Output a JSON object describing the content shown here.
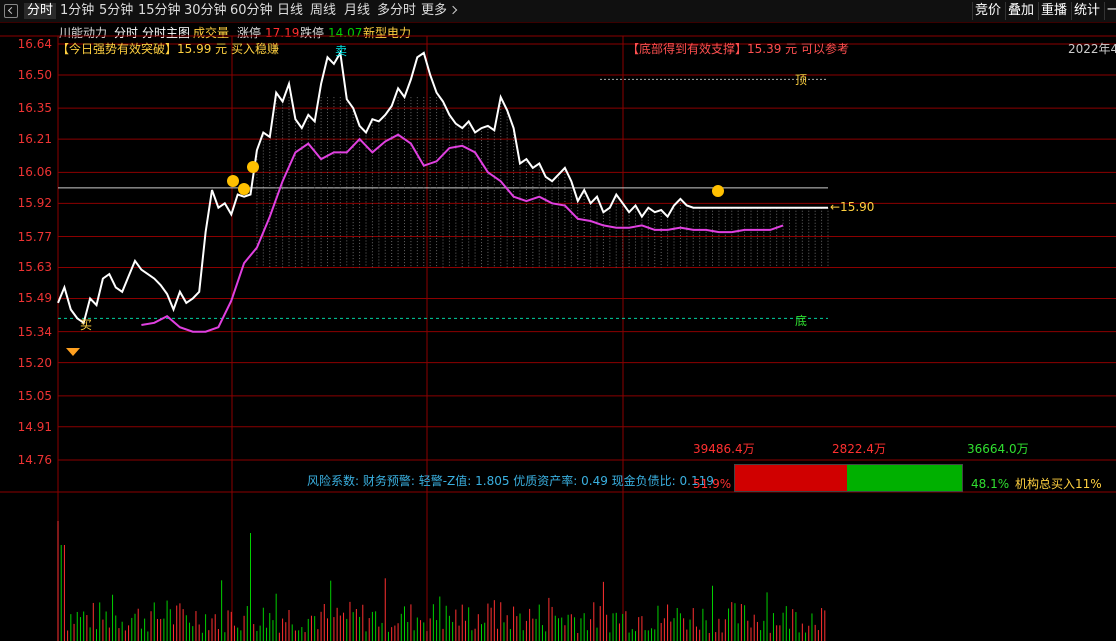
{
  "toolbar": {
    "tabs": [
      {
        "label": "分时",
        "active": true
      },
      {
        "label": "1分钟"
      },
      {
        "label": "5分钟"
      },
      {
        "label": "15分钟"
      },
      {
        "label": "30分钟"
      },
      {
        "label": "60分钟"
      },
      {
        "label": "日线"
      },
      {
        "label": "周线"
      },
      {
        "label": "月线"
      },
      {
        "label": "多分时"
      },
      {
        "label": "更多"
      }
    ],
    "right_buttons": [
      "竞价",
      "叠加",
      "重播",
      "统计"
    ],
    "right_edge_text": "一"
  },
  "header": {
    "stock_name": "川能动力",
    "items": [
      "分时",
      "分时主图",
      "成交量"
    ],
    "limit_up_label": "涨停",
    "limit_up_value": "17.19",
    "limit_down_label": "跌停",
    "limit_down_value": "14.07",
    "concept": "新型电力"
  },
  "annotations": {
    "left_note": "【今日强势有效突破】15.99 元 买入稳赚",
    "right_note": "【底部得到有效支撑】15.39 元 可以参考",
    "date": "2022年4",
    "top_label": "顶",
    "bottom_label": "底",
    "buy_label": "买",
    "sell_label": "卖",
    "price_marker": "←15.90"
  },
  "y_axis_labels": [
    "16.64",
    "16.50",
    "16.35",
    "16.21",
    "16.06",
    "15.92",
    "15.77",
    "15.63",
    "15.49",
    "15.34",
    "15.20",
    "15.05",
    "14.91",
    "14.76"
  ],
  "risk": {
    "text": "风险系数: 财务预警: 轻警-Z值: 1.805 优质资产率: 0.49 现金负债比: 0.119"
  },
  "flow": {
    "total": "39486.4万",
    "red_amount": "2822.4万",
    "green_amount": "36664.0万",
    "red_pct": "51.9%",
    "green_pct": "48.1%",
    "red_fraction": 0.519,
    "institution": "机构总买入11%"
  },
  "colors": {
    "price_line": "#ffffff",
    "avg_line": "#e040e0",
    "grid": "#8b0000",
    "up": "#ff3030",
    "down": "#00d000",
    "accent_yellow": "#ffd040",
    "cyan": "#00e5e5"
  },
  "chart_data": {
    "type": "line",
    "y_ticks": [
      16.64,
      16.5,
      16.35,
      16.21,
      16.06,
      15.92,
      15.77,
      15.63,
      15.49,
      15.34,
      15.2,
      15.05,
      14.91,
      14.76
    ],
    "ylim": [
      14.76,
      16.64
    ],
    "series": [
      {
        "key": "price",
        "x": [
          0,
          2,
          4,
          6,
          8,
          10,
          12,
          14,
          16,
          18,
          20,
          22,
          24,
          26,
          28,
          30,
          32,
          34,
          36,
          38,
          40,
          42,
          44,
          46,
          48,
          50,
          52,
          54,
          56,
          58,
          60,
          62,
          64,
          66,
          68,
          70,
          72,
          74,
          76,
          78,
          80,
          82,
          84,
          86,
          88,
          90,
          92,
          94,
          96,
          98,
          100,
          102,
          104,
          106,
          108,
          110,
          112,
          114,
          116,
          118,
          120,
          122,
          124,
          126,
          128,
          130,
          132,
          134,
          136,
          138,
          140,
          142,
          144,
          146,
          148,
          150,
          152,
          154,
          156,
          158,
          160,
          162,
          164,
          166,
          168,
          170,
          172,
          174,
          176,
          178,
          180,
          182,
          184,
          186,
          188,
          190,
          192,
          194,
          196,
          198,
          200,
          202,
          204,
          206,
          208,
          210,
          212,
          214,
          216,
          218,
          220,
          222,
          224,
          226,
          228,
          230,
          232,
          234,
          236,
          238,
          240
        ],
        "values": [
          15.47,
          15.54,
          15.44,
          15.4,
          15.38,
          15.49,
          15.46,
          15.58,
          15.6,
          15.54,
          15.52,
          15.59,
          15.66,
          15.62,
          15.6,
          15.58,
          15.55,
          15.51,
          15.44,
          15.52,
          15.47,
          15.49,
          15.52,
          15.79,
          15.98,
          15.9,
          15.92,
          15.87,
          15.96,
          15.95,
          15.96,
          16.16,
          16.24,
          16.22,
          16.42,
          16.38,
          16.46,
          16.3,
          16.26,
          16.32,
          16.29,
          16.46,
          16.58,
          16.55,
          16.6,
          16.39,
          16.35,
          16.27,
          16.24,
          16.3,
          16.29,
          16.32,
          16.36,
          16.44,
          16.4,
          16.48,
          16.58,
          16.6,
          16.5,
          16.42,
          16.38,
          16.32,
          16.28,
          16.26,
          16.29,
          16.24,
          16.26,
          16.27,
          16.25,
          16.4,
          16.34,
          16.26,
          16.1,
          16.12,
          16.08,
          16.1,
          16.04,
          16.02,
          16.05,
          16.08,
          16.02,
          15.93,
          15.98,
          15.92,
          15.95,
          15.88,
          15.9,
          15.96,
          15.92,
          15.88,
          15.91,
          15.86,
          15.9,
          15.88,
          15.89,
          15.86,
          15.91,
          15.94,
          15.91,
          15.9,
          15.9,
          15.9,
          15.9,
          15.9,
          15.9,
          15.9,
          15.9,
          15.9,
          15.9,
          15.9,
          15.9,
          15.9,
          15.9,
          15.9,
          15.9,
          15.9,
          15.9,
          15.9,
          15.9,
          15.9,
          15.9
        ]
      },
      {
        "key": "avg",
        "x": [
          26,
          30,
          34,
          38,
          42,
          46,
          50,
          54,
          58,
          62,
          66,
          70,
          74,
          78,
          82,
          86,
          90,
          94,
          98,
          102,
          106,
          110,
          114,
          118,
          122,
          126,
          130,
          134,
          138,
          142,
          146,
          150,
          154,
          158,
          162,
          166,
          170,
          174,
          178,
          182,
          186,
          190,
          194,
          198,
          202,
          206,
          210,
          214,
          218,
          222,
          226
        ],
        "values": [
          15.37,
          15.38,
          15.41,
          15.36,
          15.34,
          15.34,
          15.36,
          15.48,
          15.65,
          15.72,
          15.86,
          16.02,
          16.15,
          16.19,
          16.12,
          16.15,
          16.15,
          16.21,
          16.15,
          16.2,
          16.23,
          16.19,
          16.09,
          16.11,
          16.17,
          16.18,
          16.15,
          16.06,
          16.02,
          15.95,
          15.93,
          15.95,
          15.92,
          15.91,
          15.85,
          15.84,
          15.82,
          15.81,
          15.81,
          15.82,
          15.8,
          15.8,
          15.81,
          15.8,
          15.8,
          15.79,
          15.79,
          15.8,
          15.8,
          15.8,
          15.82
        ]
      }
    ]
  }
}
